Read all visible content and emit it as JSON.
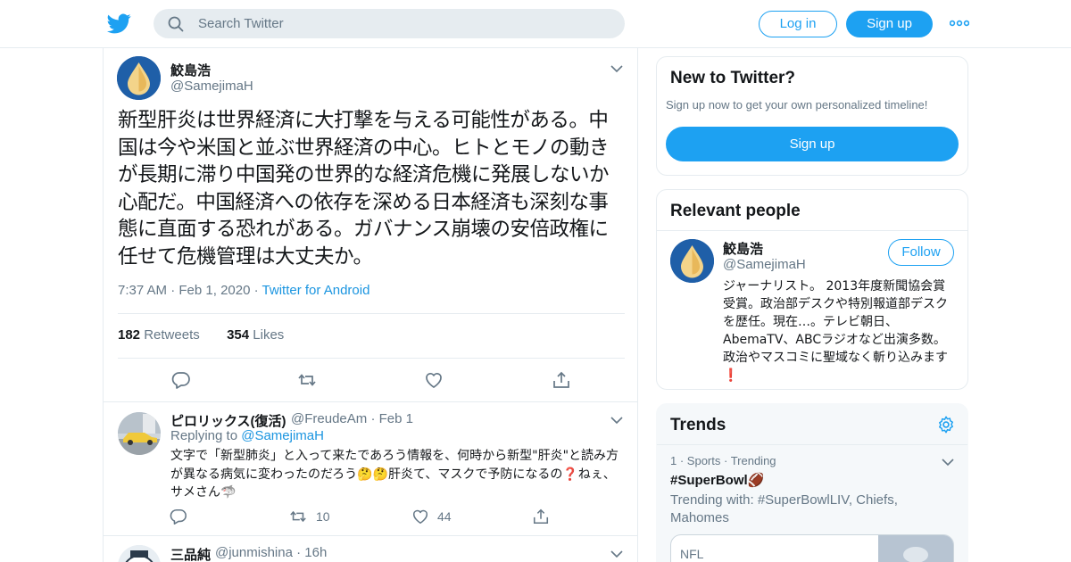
{
  "header": {
    "search_placeholder": "Search Twitter",
    "login_label": "Log in",
    "signup_label": "Sign up",
    "brand_color": "#1da1f2"
  },
  "main_tweet": {
    "author_name": "鮫島浩",
    "author_handle": "@SamejimaH",
    "text": "新型肝炎は世界経済に大打撃を与える可能性がある。中国は今や米国と並ぶ世界経済の中心。ヒトとモノの動きが長期に滞り中国発の世界的な経済危機に発展しないか心配だ。中国経済への依存を深める日本経済も深刻な事態に直面する恐れがある。ガバナンス崩壊の安倍政権に任せて危機管理は大丈夫か。",
    "time": "7:37 AM",
    "date": "Feb 1, 2020",
    "source": "Twitter for Android",
    "retweets_count": "182",
    "retweets_label": "Retweets",
    "likes_count": "354",
    "likes_label": "Likes"
  },
  "replies": [
    {
      "author_name": "ピロリックス(復活)",
      "author_handle": "@FreudeAm",
      "time": "Feb 1",
      "replying_prefix": "Replying to",
      "replying_to": "@SamejimaH",
      "text": "文字で「新型肺炎」と入って来たであろう情報を、何時から新型\"肝炎\"と読み方が異なる病気に変わったのだろう🤔🤔肝炎て、マスクで予防になるの❓ねぇ、サメさん🦈",
      "retweets": "10",
      "likes": "44"
    },
    {
      "author_name": "三品純",
      "author_handle": "@junmishina",
      "time": "16h"
    }
  ],
  "sidebar": {
    "new_to_twitter": {
      "title": "New to Twitter?",
      "subtitle": "Sign up now to get your own personalized timeline!",
      "button": "Sign up"
    },
    "relevant_people": {
      "title": "Relevant people",
      "name": "鮫島浩",
      "handle": "@SamejimaH",
      "follow_label": "Follow",
      "bio": "ジャーナリスト。 2013年度新聞協会賞受賞。政治部デスクや特別報道部デスクを歴任。現在…。テレビ朝日、AbemaTV、ABCラジオなど出演多数。政治やマスコミに聖域なく斬り込みます❗"
    },
    "trends": {
      "title": "Trends",
      "item_rank": "1",
      "item_category": "Sports",
      "item_label": "Trending",
      "item_name": "#SuperBowl🏈",
      "item_with": "Trending with: #SuperBowlLIV, Chiefs, Mahomes",
      "card_label": "NFL"
    }
  }
}
